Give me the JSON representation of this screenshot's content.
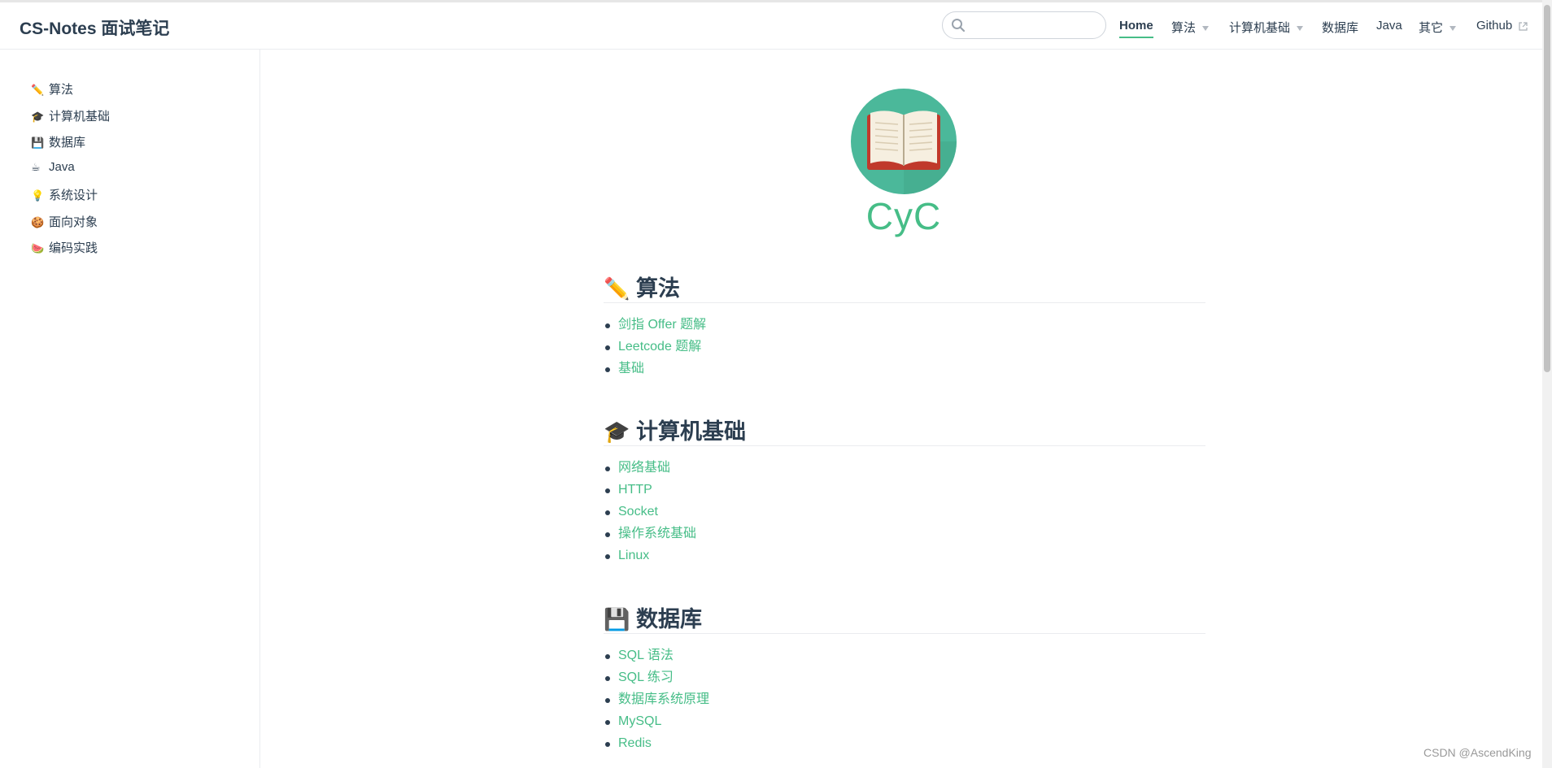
{
  "site": {
    "title": "CS-Notes 面试笔记"
  },
  "search": {
    "placeholder": "",
    "value": ""
  },
  "nav": {
    "home": "Home",
    "algorithm": "算法",
    "cs_basics": "计算机基础",
    "database": "数据库",
    "java": "Java",
    "other": "其它",
    "github": "Github"
  },
  "sidebar": {
    "items": [
      {
        "emoji": "✏️",
        "label": "算法"
      },
      {
        "emoji": "🎓",
        "label": "计算机基础"
      },
      {
        "emoji": "💾",
        "label": "数据库"
      },
      {
        "emoji": "☕",
        "label": "Java"
      },
      {
        "emoji": "💡",
        "label": "系统设计"
      },
      {
        "emoji": "🍪",
        "label": "面向对象"
      },
      {
        "emoji": "🍉",
        "label": "编码实践"
      }
    ]
  },
  "hero": {
    "title": "CyC"
  },
  "sections": [
    {
      "emoji": "✏️",
      "heading": "算法",
      "links": [
        "剑指 Offer 题解",
        "Leetcode 题解",
        "基础"
      ]
    },
    {
      "emoji": "🎓",
      "heading": "计算机基础",
      "links": [
        "网络基础",
        "HTTP",
        "Socket",
        "操作系统基础",
        "Linux"
      ]
    },
    {
      "emoji": "💾",
      "heading": "数据库",
      "links": [
        "SQL 语法",
        "SQL 练习",
        "数据库系统原理",
        "MySQL",
        "Redis"
      ]
    }
  ],
  "watermark": "CSDN @AscendKing",
  "colors": {
    "accent": "#46bd87",
    "text": "#2c3e50",
    "border": "#eaecef",
    "logo_circle": "#4bb89a",
    "book_red": "#c0392b"
  }
}
